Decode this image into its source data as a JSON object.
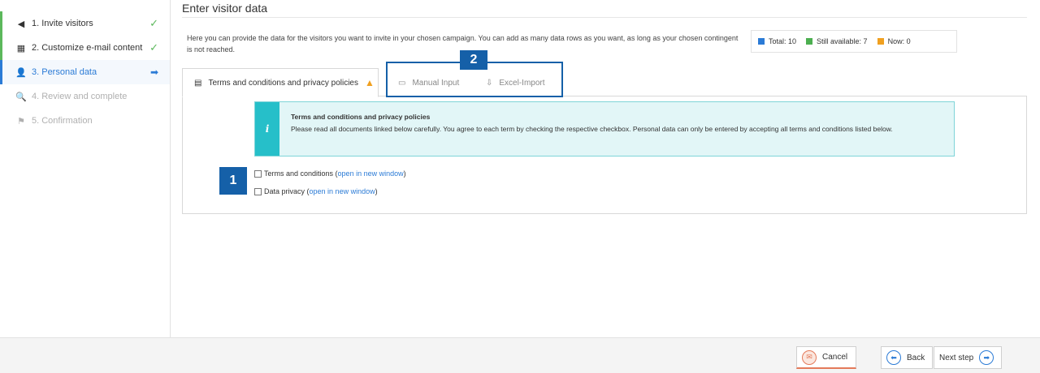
{
  "sidebar": {
    "steps": [
      {
        "label": "1. Invite visitors",
        "icon": "megaphone-icon",
        "state": "done"
      },
      {
        "label": "2. Customize e-mail content",
        "icon": "mail-template-icon",
        "state": "done"
      },
      {
        "label": "3. Personal data",
        "icon": "users-icon",
        "state": "active"
      },
      {
        "label": "4. Review and complete",
        "icon": "search-icon",
        "state": "disabled"
      },
      {
        "label": "5. Confirmation",
        "icon": "flag-icon",
        "state": "disabled"
      }
    ]
  },
  "main": {
    "title": "Enter visitor data",
    "intro": "Here you can provide the data for the visitors you want to invite in your chosen campaign. You can add as many data rows as you want, as long as your chosen contingent is not reached.",
    "legend": {
      "total": "Total: 10",
      "available": "Still available: 7",
      "now": "Now: 0"
    },
    "tabs": {
      "terms": "Terms and conditions and privacy policies",
      "manual": "Manual Input",
      "excel": "Excel-Import"
    },
    "info": {
      "icon_glyph": "i",
      "title": "Terms and conditions and privacy policies",
      "text": "Please read all documents linked below carefully. You agree to each term by checking the respective checkbox. Personal data can only be entered by accepting all terms and conditions listed below."
    },
    "checkboxes": [
      {
        "label": "Terms and conditions (",
        "link": "open in new window",
        "suffix": ")"
      },
      {
        "label": "Data privacy (",
        "link": "open in new window",
        "suffix": ")"
      }
    ]
  },
  "markers": {
    "one": "1",
    "two": "2"
  },
  "footer": {
    "cancel": "Cancel",
    "back": "Back",
    "next": "Next step"
  },
  "colors": {
    "accent": "#2b7bd6",
    "done": "#5cb85c",
    "total": "#2b7bd6",
    "available": "#4caf50",
    "now": "#f0a020",
    "info_bar": "#26bfc9",
    "marker": "#1560a8"
  }
}
